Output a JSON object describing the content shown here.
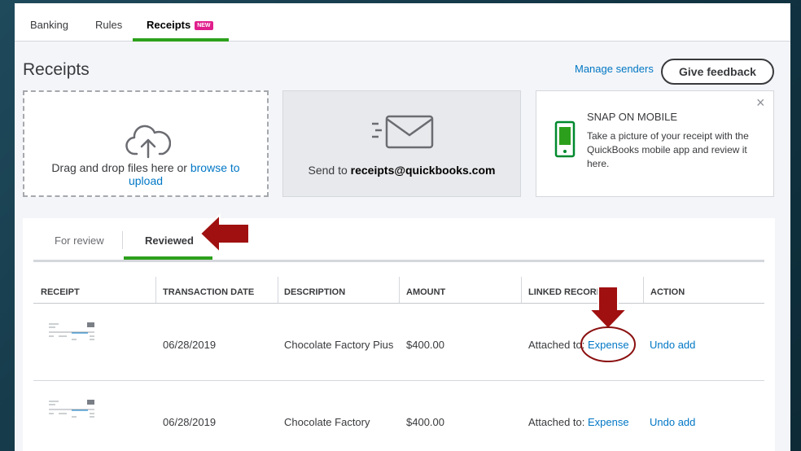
{
  "top_tabs": [
    {
      "label": "Banking"
    },
    {
      "label": "Rules"
    },
    {
      "label": "Receipts",
      "badge": "NEW"
    }
  ],
  "page_title": "Receipts",
  "manage_senders": "Manage senders",
  "give_feedback": "Give feedback",
  "upload": {
    "text": "Drag and drop files here or",
    "link_line1": "browse to",
    "link_line2": "upload"
  },
  "email": {
    "prefix": "Send to",
    "address": "receipts@quickbooks.com"
  },
  "snap": {
    "title": "SNAP ON MOBILE",
    "description": "Take a picture of your receipt with the QuickBooks mobile app and review it here.",
    "close": "×"
  },
  "sub_tabs": [
    {
      "label": "For review"
    },
    {
      "label": "Reviewed"
    }
  ],
  "columns": [
    "RECEIPT",
    "TRANSACTION DATE",
    "DESCRIPTION",
    "AMOUNT",
    "LINKED RECORD",
    "ACTION"
  ],
  "rows": [
    {
      "date": "06/28/2019",
      "description": "Chocolate Factory Pius",
      "amount": "$400.00",
      "linked_prefix": "Attached to:",
      "linked_link": "Expense",
      "action": "Undo add"
    },
    {
      "date": "06/28/2019",
      "description": "Chocolate Factory",
      "amount": "$400.00",
      "linked_prefix": "Attached to:",
      "linked_link": "Expense",
      "action": "Undo add"
    }
  ],
  "colors": {
    "accent_green": "#2ca01c",
    "link_blue": "#0077c5",
    "annotation_red": "#a01010",
    "badge_pink": "#e01e8c"
  }
}
